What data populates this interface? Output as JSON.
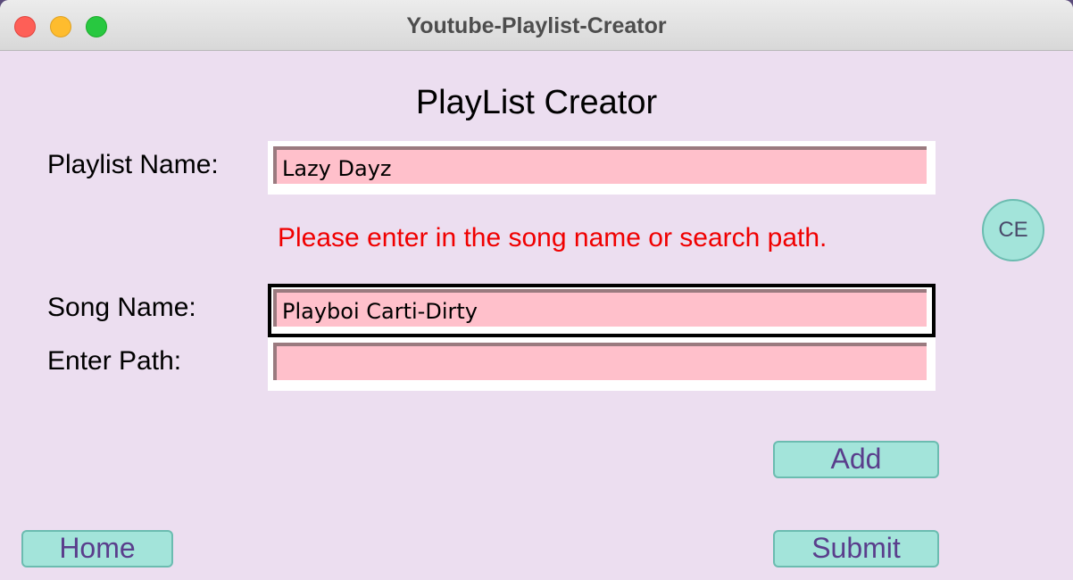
{
  "window": {
    "title": "Youtube-Playlist-Creator"
  },
  "main": {
    "heading": "PlayList Creator",
    "playlist_name_label": "Playlist Name:",
    "playlist_name_value": "Lazy Dayz",
    "error_message": "Please enter in the song name or search path.",
    "song_name_label": "Song Name:",
    "song_name_value": "Playboi Carti-Dirty",
    "enter_path_label": "Enter Path:",
    "enter_path_value": ""
  },
  "buttons": {
    "ce": "CE",
    "add": "Add",
    "home": "Home",
    "submit": "Submit"
  },
  "colors": {
    "background": "#ecdef0",
    "field": "#ffc0cb",
    "button": "#a3e4da",
    "button_text": "#5a3e8c",
    "error": "#f00000"
  }
}
